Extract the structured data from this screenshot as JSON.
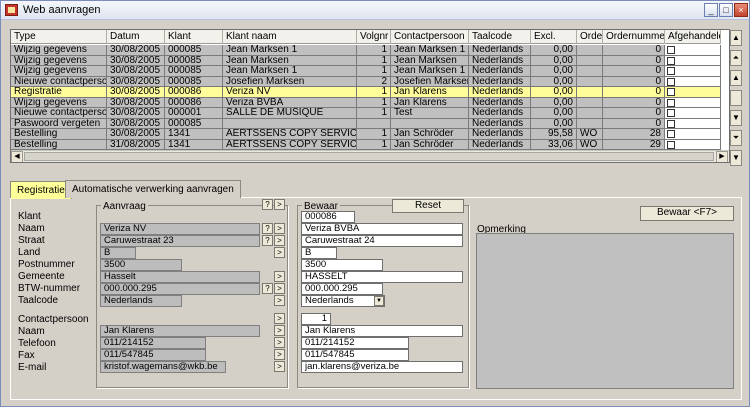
{
  "window": {
    "title": "Web aanvragen"
  },
  "table": {
    "columns": [
      "Type",
      "Datum",
      "Klant",
      "Klant naam",
      "Volgnr",
      "Contactpersoon",
      "Taalcode",
      "Excl.",
      "Order",
      "Ordernummer",
      "Afgehandeld"
    ],
    "rows": [
      [
        "Wijzig gegevens",
        "30/08/2005",
        "000085",
        "Jean Marksen 1",
        "1",
        "Jean Marksen 1",
        "Nederlands",
        "0,00",
        "",
        "0",
        ""
      ],
      [
        "Wijzig gegevens",
        "30/08/2005",
        "000085",
        "Jean Marksen",
        "1",
        "Jean Marksen",
        "Nederlands",
        "0,00",
        "",
        "0",
        ""
      ],
      [
        "Wijzig gegevens",
        "30/08/2005",
        "000085",
        "Jean Marksen 1",
        "1",
        "Jean Marksen 1",
        "Nederlands",
        "0,00",
        "",
        "0",
        ""
      ],
      [
        "Nieuwe contactpersoon",
        "30/08/2005",
        "000085",
        "Josefien Marksen",
        "2",
        "Josefien Marksen",
        "Nederlands",
        "0,00",
        "",
        "0",
        ""
      ],
      [
        "Registratie",
        "30/08/2005",
        "000086",
        "Veriza NV",
        "1",
        "Jan Klarens",
        "Nederlands",
        "0,00",
        "",
        "0",
        ""
      ],
      [
        "Wijzig gegevens",
        "30/08/2005",
        "000086",
        "Veriza BVBA",
        "1",
        "Jan Klarens",
        "Nederlands",
        "0,00",
        "",
        "0",
        ""
      ],
      [
        "Nieuwe contactpersoon",
        "30/08/2005",
        "000001",
        "SALLE DE MUSIQUE",
        "1",
        "Test",
        "Nederlands",
        "0,00",
        "",
        "0",
        ""
      ],
      [
        "Paswoord vergeten",
        "30/08/2005",
        "000085",
        "",
        "",
        "",
        "Nederlands",
        "0,00",
        "",
        "0",
        ""
      ],
      [
        "Bestelling",
        "30/08/2005",
        "1341",
        "AERTSSENS COPY SERVICE",
        "1",
        "Jan Schröder",
        "Nederlands",
        "95,58",
        "WO",
        "28",
        ""
      ],
      [
        "Bestelling",
        "31/08/2005",
        "1341",
        "AERTSSENS COPY SERVICE",
        "1",
        "Jan Schröder",
        "Nederlands",
        "33,06",
        "WO",
        "29",
        ""
      ]
    ]
  },
  "tabs": [
    "Registratie",
    "Automatische verwerking aanvragen"
  ],
  "form": {
    "aanvraag_label": "Aanvraag",
    "bewaar_label": "Bewaar",
    "reset_label": "Reset",
    "save_button": "Bewaar <F7>",
    "opmerking_label": "Opmerking",
    "labels": {
      "klant": "Klant",
      "naam": "Naam",
      "straat": "Straat",
      "land": "Land",
      "postnummer": "Postnummer",
      "gemeente": "Gemeente",
      "btw": "BTW-nummer",
      "taalcode": "Taalcode",
      "contactpersoon": "Contactpersoon",
      "cnaam": "Naam",
      "telefoon": "Telefoon",
      "fax": "Fax",
      "email": "E-mail"
    },
    "aanvraag": {
      "naam": "Veriza NV",
      "straat": "Caruwestraat 23",
      "land": "B",
      "postnummer": "3500",
      "gemeente": "Hasselt",
      "btw": "000.000.295",
      "taalcode": "Nederlands",
      "cnaam": "Jan Klarens",
      "telefoon": "011/214152",
      "fax": "011/547845",
      "email": "kristof.wagemans@wkb.be"
    },
    "bewaar": {
      "klant": "000086",
      "naam": "Veriza BVBA",
      "straat": "Caruwestraat 24",
      "land": "B",
      "postnummer": "3500",
      "gemeente": "HASSELT",
      "btw": "000.000.295",
      "taalcode": "Nederlands",
      "contact_nr": "1",
      "cnaam": "Jan Klarens",
      "telefoon": "011/214152",
      "fax": "011/547845",
      "email": "jan.klarens@veriza.be"
    },
    "btn_q": "?",
    "btn_go": ">"
  }
}
